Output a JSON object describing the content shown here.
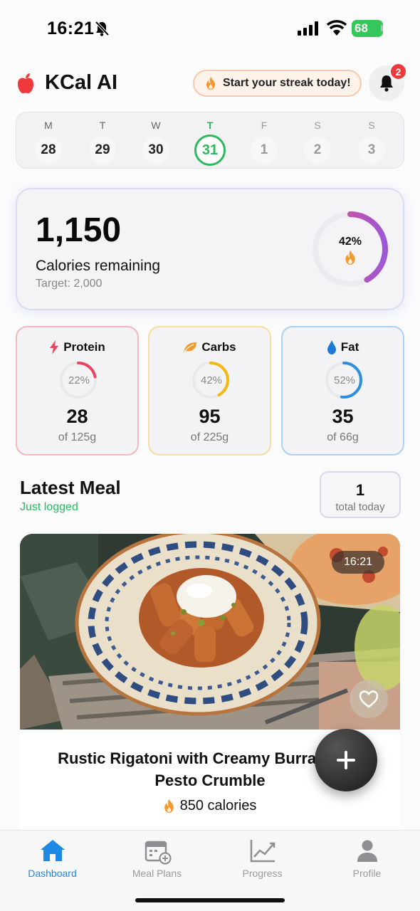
{
  "status_bar": {
    "time": "16:21",
    "battery": "68"
  },
  "header": {
    "app_title": "KCal AI",
    "streak_text": "Start your streak today!",
    "notification_count": "2"
  },
  "week": [
    {
      "letter": "M",
      "num": "28",
      "state": "past"
    },
    {
      "letter": "T",
      "num": "29",
      "state": "past"
    },
    {
      "letter": "W",
      "num": "30",
      "state": "past"
    },
    {
      "letter": "T",
      "num": "31",
      "state": "today"
    },
    {
      "letter": "F",
      "num": "1",
      "state": "future"
    },
    {
      "letter": "S",
      "num": "2",
      "state": "future"
    },
    {
      "letter": "S",
      "num": "3",
      "state": "future"
    }
  ],
  "calories": {
    "remaining": "1,150",
    "label": "Calories remaining",
    "target": "Target: 2,000",
    "percent_text": "42%",
    "percent": 42
  },
  "macros": {
    "protein": {
      "name": "Protein",
      "percent_text": "22%",
      "percent": 22,
      "value": "28",
      "of": "of 125g",
      "color": "#e94560"
    },
    "carbs": {
      "name": "Carbs",
      "percent_text": "42%",
      "percent": 42,
      "value": "95",
      "of": "of 225g",
      "color": "#f5b914"
    },
    "fat": {
      "name": "Fat",
      "percent_text": "52%",
      "percent": 52,
      "value": "35",
      "of": "of 66g",
      "color": "#2d8fe0"
    }
  },
  "latest_meal": {
    "title": "Latest Meal",
    "subtitle": "Just logged",
    "count": "1",
    "count_label": "total today",
    "time": "16:21",
    "name": "Rustic Rigatoni with Creamy Burrata and Pesto Crumble",
    "calories": "850 calories"
  },
  "tabs": [
    {
      "label": "Dashboard",
      "icon": "home-icon",
      "active": true
    },
    {
      "label": "Meal Plans",
      "icon": "calendar-plus-icon",
      "active": false
    },
    {
      "label": "Progress",
      "icon": "chart-icon",
      "active": false
    },
    {
      "label": "Profile",
      "icon": "person-icon",
      "active": false
    }
  ],
  "colors": {
    "accent_green": "#2eb85c",
    "accent_blue": "#1e88e5",
    "streak_orange": "#f29a2e"
  }
}
